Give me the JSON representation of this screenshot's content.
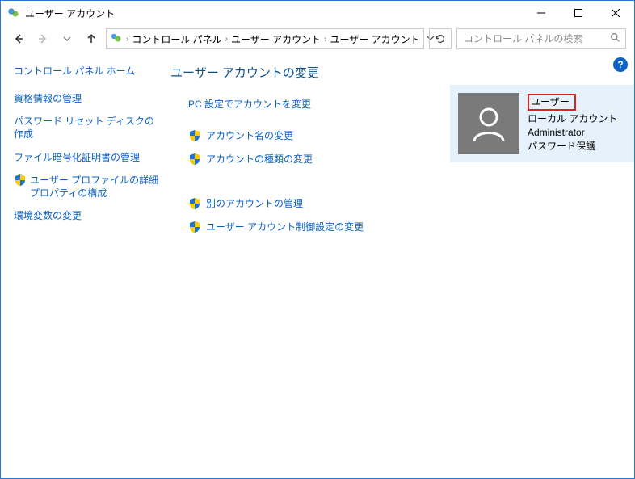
{
  "window": {
    "title": "ユーザー アカウント"
  },
  "breadcrumb": {
    "items": [
      "コントロール パネル",
      "ユーザー アカウント",
      "ユーザー アカウント"
    ]
  },
  "search": {
    "placeholder": "コントロール パネルの検索"
  },
  "leftnav": {
    "home": "コントロール パネル ホーム",
    "items": [
      {
        "label": "資格情報の管理",
        "shield": false
      },
      {
        "label": "パスワード リセット ディスクの作成",
        "shield": false
      },
      {
        "label": "ファイル暗号化証明書の管理",
        "shield": false
      },
      {
        "label": "ユーザー プロファイルの詳細プロパティの構成",
        "shield": true
      },
      {
        "label": "環境変数の変更",
        "shield": false
      }
    ]
  },
  "main": {
    "heading": "ユーザー アカウントの変更",
    "tasks": [
      {
        "label": "PC 設定でアカウントを変更",
        "shield": false
      },
      {
        "label": "アカウント名の変更",
        "shield": true
      },
      {
        "label": "アカウントの種類の変更",
        "shield": true
      }
    ],
    "tasks2": [
      {
        "label": "別のアカウントの管理",
        "shield": true
      },
      {
        "label": "ユーザー アカウント制御設定の変更",
        "shield": true
      }
    ]
  },
  "user": {
    "name": "ユーザー",
    "line1": "ローカル アカウント",
    "line2": "Administrator",
    "line3": "パスワード保護"
  }
}
